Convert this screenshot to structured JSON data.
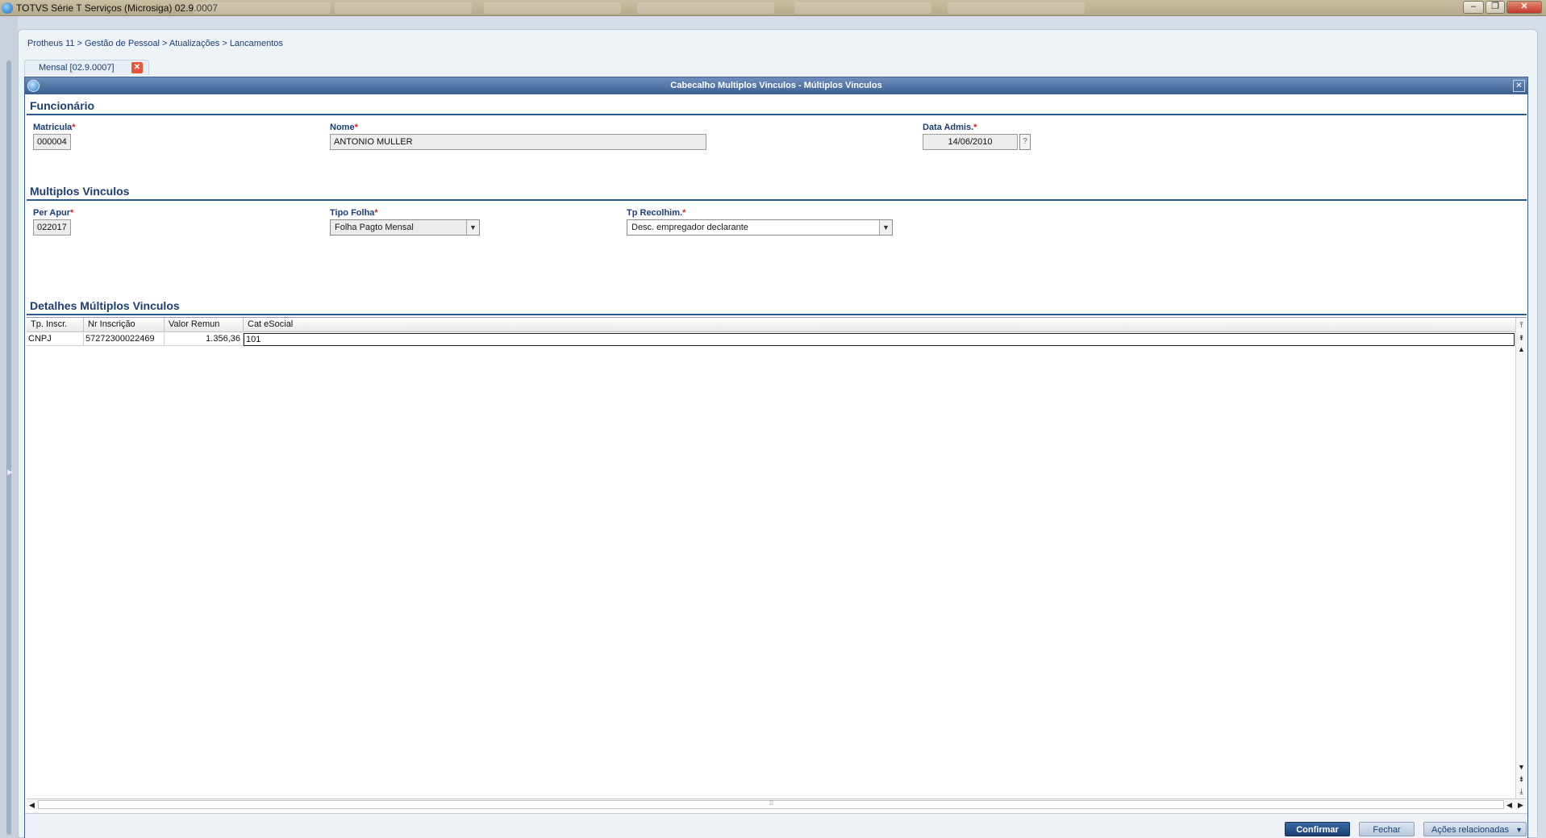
{
  "window": {
    "title": "TOTVS Série T Serviços (Microsiga) 02.9.0007",
    "minimize_glyph": "–",
    "restore_glyph": "❐",
    "close_glyph": "✕"
  },
  "breadcrumb": "Protheus 11 > Gestão de Pessoal > Atualizações > Lancamentos",
  "tab": {
    "label": "Mensal [02.9.0007]",
    "close_glyph": "✕"
  },
  "dialog": {
    "title": "Cabecalho Multiplos Vinculos - Múltiplos Vinculos",
    "close_glyph": "✕"
  },
  "funcionario": {
    "section_title": "Funcionário",
    "matricula": {
      "label": "Matricula",
      "value": "000004"
    },
    "nome": {
      "label": "Nome",
      "value": "ANTONIO MULLER"
    },
    "data_admis": {
      "label": "Data Admis.",
      "value": "14/06/2010",
      "help": "?"
    }
  },
  "multiplos": {
    "section_title": "Multiplos Vinculos",
    "per_apur": {
      "label": "Per Apur",
      "value": "022017"
    },
    "tipo_folha": {
      "label": "Tipo Folha",
      "value": "Folha Pagto Mensal"
    },
    "tp_recolhim": {
      "label": "Tp Recolhim.",
      "value": "Desc. empregador declarante"
    }
  },
  "required_mark": "*",
  "detalhes": {
    "section_title": "Detalhes Múltiplos Vinculos",
    "columns": [
      "Tp. Inscr.",
      "Nr Inscrição",
      "Valor Remun",
      "Cat eSocial"
    ],
    "rows": [
      [
        "CNPJ",
        "57272300022469",
        "1.356,36",
        "101"
      ]
    ]
  },
  "footer": {
    "confirmar": "Confirmar",
    "fechar": "Fechar",
    "acoes": "Ações relacionadas"
  },
  "icons": {
    "app": "totvs-logo-icon",
    "dropdown": "chevron-down-icon",
    "scroll_up": "arrow-up-icon",
    "scroll_down": "arrow-down-icon"
  },
  "colors": {
    "accent": "#1b3e73",
    "dialog_header": "#3b5f94",
    "required": "#d21d1d",
    "tab_close": "#e2573a",
    "primary_button": "#18406f"
  }
}
